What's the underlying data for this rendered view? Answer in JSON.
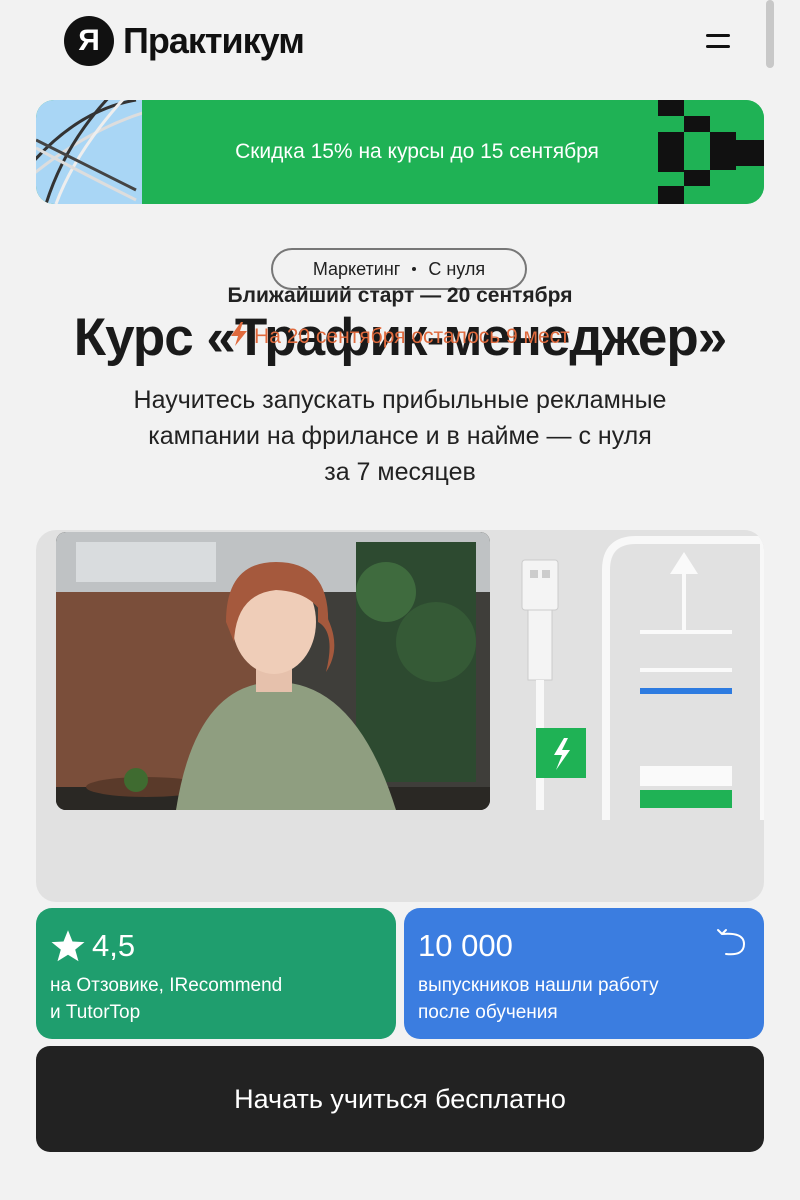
{
  "header": {
    "logo_letter": "Я",
    "logo_text": "Практикум"
  },
  "promo": {
    "text": "Скидка 15% на курсы до 15 сентября"
  },
  "tags": [
    "Маркетинг",
    "С нуля"
  ],
  "course": {
    "title": "Курс «Трафик-менеджер»",
    "subtitle_lines": [
      "Научитесь запускать прибыльные рекламные",
      "кампании на фрилансе и в найме — с нуля",
      "за 7 месяцев"
    ]
  },
  "hero": {
    "start": "Ближайший старт — 20 сентября",
    "seats": "На 20 сентября осталось 9 мест"
  },
  "stats": {
    "rating_value": "4,5",
    "rating_desc": [
      "на Отзовике, IRecommend",
      "и TutorTop"
    ],
    "grads_value": "10 000",
    "grads_desc": [
      "выпускников нашли работу",
      "после обучения"
    ]
  },
  "cta": {
    "label": "Начать учиться бесплатно"
  },
  "colors": {
    "green": "#1fb255",
    "teal": "#1f9e6e",
    "blue": "#3b7de0",
    "orange": "#e06a3d",
    "dark": "#222222"
  }
}
